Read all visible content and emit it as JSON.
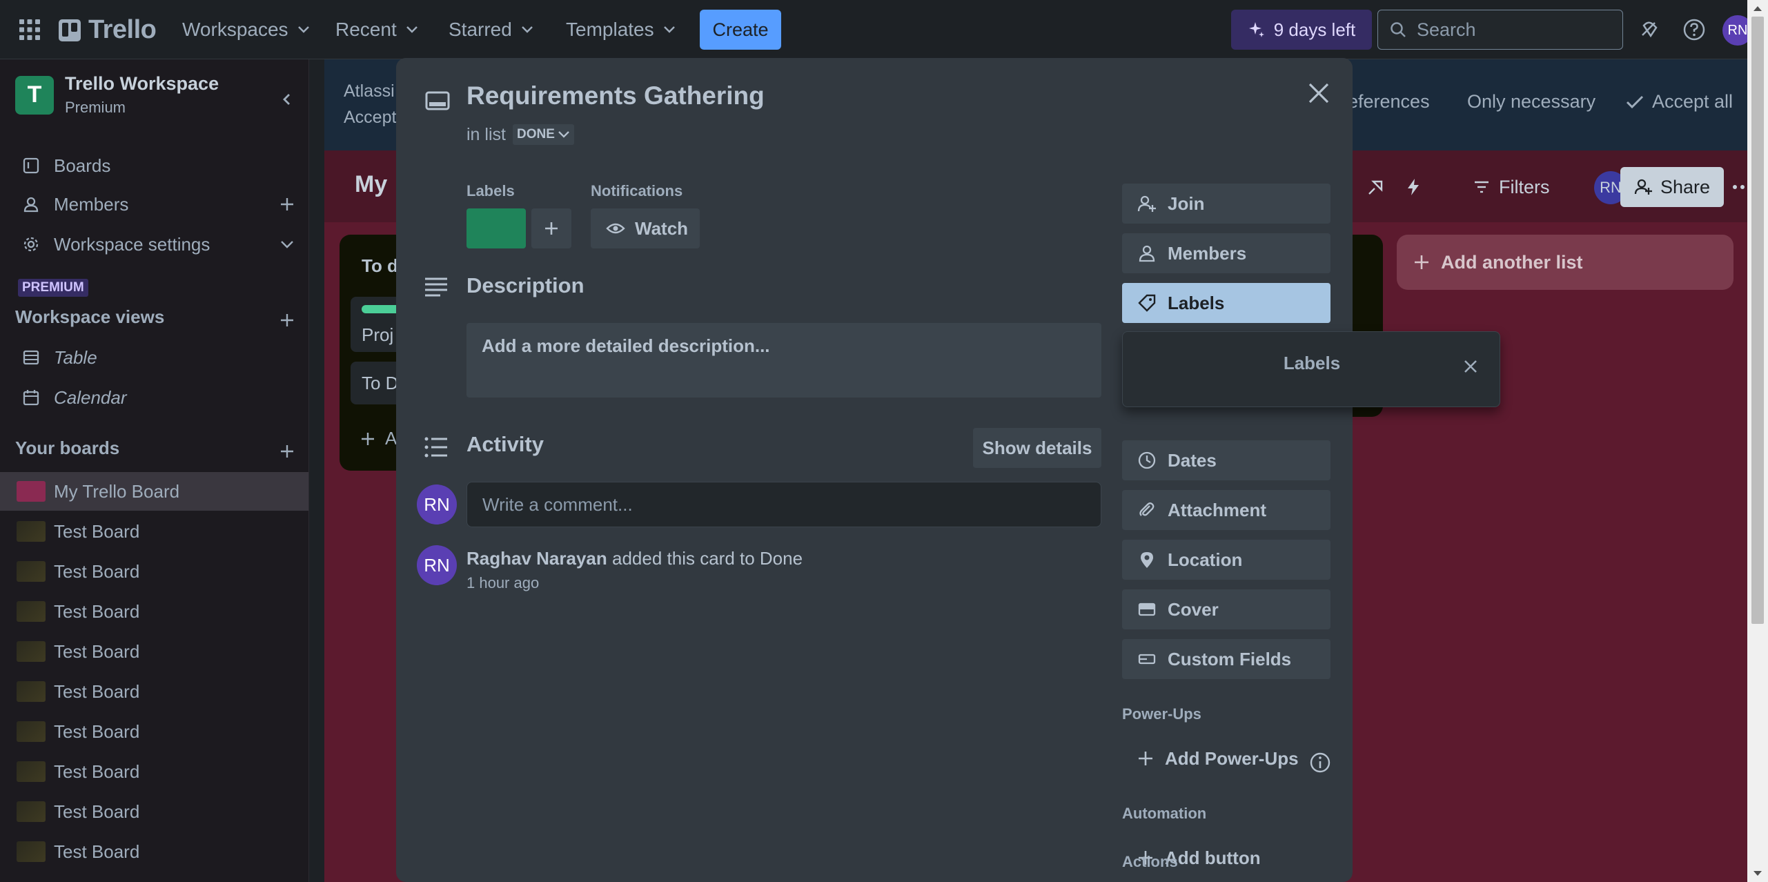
{
  "topbar": {
    "logo": "Trello",
    "nav": [
      "Workspaces",
      "Recent",
      "Starred",
      "Templates"
    ],
    "create": "Create",
    "trial": "9 days left",
    "search_placeholder": "Search",
    "avatar": "RN"
  },
  "sidebar": {
    "workspace_initial": "T",
    "workspace_name": "Trello Workspace",
    "workspace_plan": "Premium",
    "items": [
      "Boards",
      "Members",
      "Workspace settings"
    ],
    "premium_tag": "PREMIUM",
    "views_title": "Workspace views",
    "views": [
      "Table",
      "Calendar"
    ],
    "boards_title": "Your boards",
    "boards": [
      "My Trello Board",
      "Test Board",
      "Test Board",
      "Test Board",
      "Test Board",
      "Test Board",
      "Test Board",
      "Test Board",
      "Test Board",
      "Test Board"
    ]
  },
  "board": {
    "cookie_text_1": "Atlassi",
    "cookie_text_2": "Accept",
    "cookie_preferences": "references",
    "cookie_only_necessary": "Only necessary",
    "cookie_accept_all": "Accept all",
    "title_fragment": "My",
    "filters": "Filters",
    "member_avatar": "RN",
    "share": "Share",
    "list1_title_fragment": "To d",
    "list1_card1_fragment": "Proj",
    "list1_card2_fragment": "To D",
    "list1_add_fragment": "A",
    "add_another_list": "Add another list"
  },
  "modal": {
    "title": "Requirements Gathering",
    "in_list_prefix": "in list",
    "list_name": "DONE",
    "labels_heading": "Labels",
    "notifications_heading": "Notifications",
    "watch": "Watch",
    "description_title": "Description",
    "description_placeholder": "Add a more detailed description...",
    "activity_title": "Activity",
    "show_details": "Show details",
    "comment_placeholder": "Write a comment...",
    "commenter_avatar": "RN",
    "activity_avatar": "RN",
    "activity_user": "Raghav Narayan",
    "activity_text": " added this card to Done",
    "activity_time": "1 hour ago",
    "sidebar_buttons": {
      "join": "Join",
      "members": "Members",
      "labels": "Labels",
      "dates": "Dates",
      "attachment": "Attachment",
      "location": "Location",
      "cover": "Cover",
      "custom_fields": "Custom Fields"
    },
    "powerups_heading": "Power-Ups",
    "add_powerups": "Add Power-Ups",
    "automation_heading": "Automation",
    "add_button": "Add button",
    "actions_heading": "Actions",
    "label_color": "#1f845a"
  },
  "popover": {
    "title": "Labels"
  },
  "colors": {
    "accent": "#579dff",
    "board_bg": "#5c1a2e",
    "label_green": "#1f845a",
    "avatar_purple": "#5a3fb3"
  }
}
